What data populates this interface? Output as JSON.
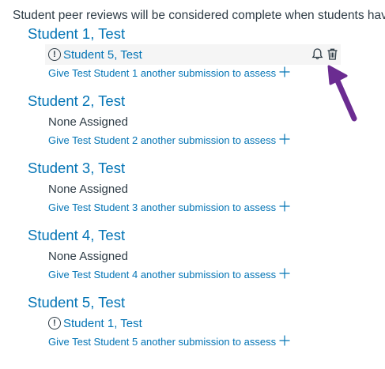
{
  "intro_text": "Student peer reviews will be considered complete when students hav",
  "students": [
    {
      "name": "Student 1, Test",
      "reviewer": "Student 5, Test",
      "none_label": "",
      "give_label": "Give Test Student 1 another submission to assess"
    },
    {
      "name": "Student 2, Test",
      "reviewer": "",
      "none_label": "None Assigned",
      "give_label": "Give Test Student 2 another submission to assess"
    },
    {
      "name": "Student 3, Test",
      "reviewer": "",
      "none_label": "None Assigned",
      "give_label": "Give Test Student 3 another submission to assess"
    },
    {
      "name": "Student 4, Test",
      "reviewer": "",
      "none_label": "None Assigned",
      "give_label": "Give Test Student 4 another submission to assess"
    },
    {
      "name": "Student 5, Test",
      "reviewer": "Student 1, Test",
      "none_label": "",
      "give_label": "Give Test Student 5 another submission to assess"
    }
  ],
  "icons": {
    "alert": "alert-circle-icon",
    "remind": "bell-icon",
    "delete": "trash-icon",
    "add": "plus-icon",
    "annotation": "arrow-annotation-icon"
  },
  "colors": {
    "link": "#0374b5",
    "text": "#2d3b45",
    "highlight_row": "#f5f5f5",
    "annotation_arrow": "#6b2c91"
  },
  "alert_glyph": "!"
}
